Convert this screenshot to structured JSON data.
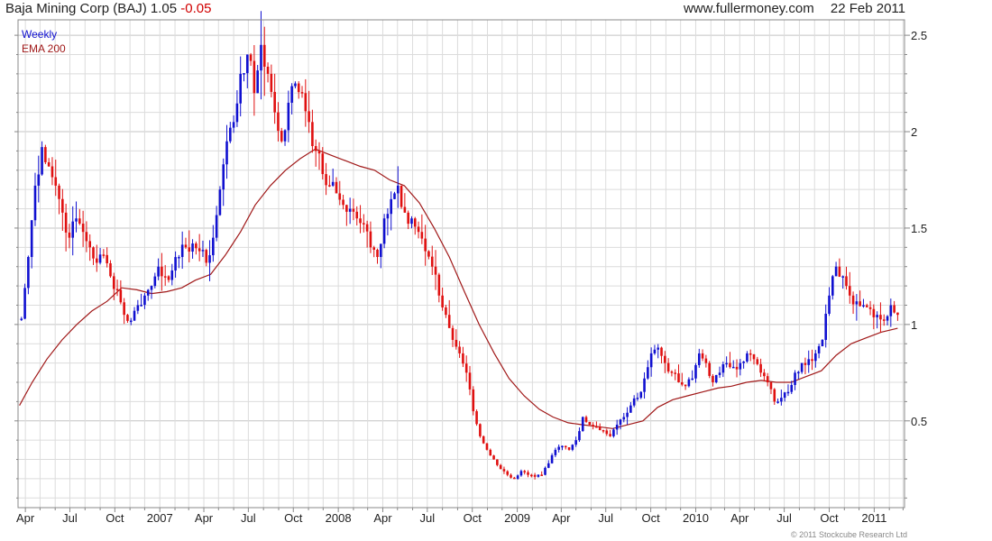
{
  "header": {
    "symbol": "Baja Mining Corp (BAJ)",
    "price": "1.05",
    "change": "-0.05",
    "site": "www.fullermoney.com",
    "date": "22 Feb 2011"
  },
  "footer": {
    "copyright": "© 2011 Stockcube Research Ltd"
  },
  "colors": {
    "up": "#1010d0",
    "down": "#e01010",
    "ema": "#a01818",
    "grid": "#dcdcdc",
    "major_grid": "#c4c4c4",
    "frame": "#888888"
  },
  "chart_data": {
    "type": "line",
    "title": "Baja Mining Corp (BAJ)",
    "interval": "Weekly",
    "x_ticks": [
      "Apr",
      "Jul",
      "Oct",
      "2007",
      "Apr",
      "Jul",
      "Oct",
      "2008",
      "Apr",
      "Jul",
      "Oct",
      "2009",
      "Apr",
      "Jul",
      "Oct",
      "2010",
      "Apr",
      "Jul",
      "Oct",
      "2011"
    ],
    "x_tick_dates": [
      "2006-04-01",
      "2006-07-01",
      "2006-10-01",
      "2007-01-01",
      "2007-04-01",
      "2007-07-01",
      "2007-10-01",
      "2008-01-01",
      "2008-04-01",
      "2008-07-01",
      "2008-10-01",
      "2009-01-01",
      "2009-04-01",
      "2009-07-01",
      "2009-10-01",
      "2010-01-01",
      "2010-04-01",
      "2010-07-01",
      "2010-10-01",
      "2011-01-01"
    ],
    "x_range": [
      "2006-03-17",
      "2011-03-04"
    ],
    "y_ticks": [
      0.5,
      1,
      1.5,
      2,
      2.5
    ],
    "ylim": [
      0.05,
      2.58
    ],
    "grid": true,
    "legend_position": "top-left",
    "series": [
      {
        "name": "Weekly",
        "kind": "price",
        "points": [
          [
            "2006-03-24",
            1.03
          ],
          [
            "2006-04-07",
            1.35
          ],
          [
            "2006-04-21",
            1.72
          ],
          [
            "2006-05-05",
            1.92
          ],
          [
            "2006-05-19",
            1.82
          ],
          [
            "2006-06-02",
            1.72
          ],
          [
            "2006-06-16",
            1.58
          ],
          [
            "2006-06-30",
            1.45
          ],
          [
            "2006-07-14",
            1.55
          ],
          [
            "2006-07-28",
            1.48
          ],
          [
            "2006-08-11",
            1.4
          ],
          [
            "2006-08-25",
            1.32
          ],
          [
            "2006-09-08",
            1.36
          ],
          [
            "2006-09-22",
            1.25
          ],
          [
            "2006-10-06",
            1.18
          ],
          [
            "2006-10-20",
            1.05
          ],
          [
            "2006-11-03",
            1.02
          ],
          [
            "2006-11-17",
            1.1
          ],
          [
            "2006-12-01",
            1.15
          ],
          [
            "2006-12-15",
            1.2
          ],
          [
            "2006-12-29",
            1.3
          ],
          [
            "2007-01-12",
            1.25
          ],
          [
            "2007-01-26",
            1.28
          ],
          [
            "2007-02-09",
            1.35
          ],
          [
            "2007-02-23",
            1.4
          ],
          [
            "2007-03-09",
            1.42
          ],
          [
            "2007-03-23",
            1.38
          ],
          [
            "2007-04-06",
            1.32
          ],
          [
            "2007-04-20",
            1.45
          ],
          [
            "2007-05-04",
            1.7
          ],
          [
            "2007-05-18",
            1.95
          ],
          [
            "2007-06-01",
            2.05
          ],
          [
            "2007-06-15",
            2.3
          ],
          [
            "2007-06-29",
            2.4
          ],
          [
            "2007-07-13",
            2.2
          ],
          [
            "2007-07-27",
            2.45
          ],
          [
            "2007-08-10",
            2.3
          ],
          [
            "2007-08-24",
            2.1
          ],
          [
            "2007-09-07",
            1.95
          ],
          [
            "2007-09-21",
            2.15
          ],
          [
            "2007-10-05",
            2.25
          ],
          [
            "2007-10-19",
            2.2
          ],
          [
            "2007-11-02",
            2.05
          ],
          [
            "2007-11-16",
            1.9
          ],
          [
            "2007-11-30",
            1.78
          ],
          [
            "2007-12-14",
            1.72
          ],
          [
            "2007-12-28",
            1.68
          ],
          [
            "2008-01-11",
            1.62
          ],
          [
            "2008-01-25",
            1.6
          ],
          [
            "2008-02-08",
            1.55
          ],
          [
            "2008-02-22",
            1.52
          ],
          [
            "2008-03-07",
            1.4
          ],
          [
            "2008-03-21",
            1.35
          ],
          [
            "2008-04-04",
            1.55
          ],
          [
            "2008-04-18",
            1.65
          ],
          [
            "2008-05-02",
            1.72
          ],
          [
            "2008-05-16",
            1.58
          ],
          [
            "2008-05-30",
            1.55
          ],
          [
            "2008-06-13",
            1.48
          ],
          [
            "2008-06-27",
            1.38
          ],
          [
            "2008-07-11",
            1.3
          ],
          [
            "2008-07-25",
            1.15
          ],
          [
            "2008-08-08",
            1.05
          ],
          [
            "2008-08-22",
            0.92
          ],
          [
            "2008-09-05",
            0.85
          ],
          [
            "2008-09-19",
            0.75
          ],
          [
            "2008-10-03",
            0.55
          ],
          [
            "2008-10-17",
            0.42
          ],
          [
            "2008-10-31",
            0.35
          ],
          [
            "2008-11-14",
            0.3
          ],
          [
            "2008-11-28",
            0.25
          ],
          [
            "2008-12-12",
            0.22
          ],
          [
            "2008-12-26",
            0.2
          ],
          [
            "2009-01-09",
            0.24
          ],
          [
            "2009-01-23",
            0.22
          ],
          [
            "2009-02-06",
            0.21
          ],
          [
            "2009-02-20",
            0.22
          ],
          [
            "2009-03-06",
            0.28
          ],
          [
            "2009-03-20",
            0.35
          ],
          [
            "2009-04-03",
            0.37
          ],
          [
            "2009-04-17",
            0.35
          ],
          [
            "2009-05-01",
            0.4
          ],
          [
            "2009-05-15",
            0.52
          ],
          [
            "2009-05-29",
            0.48
          ],
          [
            "2009-06-12",
            0.47
          ],
          [
            "2009-06-26",
            0.45
          ],
          [
            "2009-07-10",
            0.42
          ],
          [
            "2009-07-24",
            0.48
          ],
          [
            "2009-08-07",
            0.52
          ],
          [
            "2009-08-21",
            0.58
          ],
          [
            "2009-09-04",
            0.62
          ],
          [
            "2009-09-18",
            0.72
          ],
          [
            "2009-10-02",
            0.85
          ],
          [
            "2009-10-16",
            0.88
          ],
          [
            "2009-10-30",
            0.8
          ],
          [
            "2009-11-13",
            0.75
          ],
          [
            "2009-11-27",
            0.7
          ],
          [
            "2009-12-11",
            0.68
          ],
          [
            "2009-12-25",
            0.72
          ],
          [
            "2010-01-08",
            0.85
          ],
          [
            "2010-01-22",
            0.8
          ],
          [
            "2010-02-05",
            0.7
          ],
          [
            "2010-02-19",
            0.75
          ],
          [
            "2010-03-05",
            0.8
          ],
          [
            "2010-03-19",
            0.78
          ],
          [
            "2010-04-02",
            0.8
          ],
          [
            "2010-04-16",
            0.85
          ],
          [
            "2010-04-30",
            0.82
          ],
          [
            "2010-05-14",
            0.75
          ],
          [
            "2010-05-28",
            0.7
          ],
          [
            "2010-06-11",
            0.6
          ],
          [
            "2010-06-25",
            0.62
          ],
          [
            "2010-07-09",
            0.65
          ],
          [
            "2010-07-23",
            0.75
          ],
          [
            "2010-08-06",
            0.8
          ],
          [
            "2010-08-20",
            0.82
          ],
          [
            "2010-09-03",
            0.85
          ],
          [
            "2010-09-17",
            0.92
          ],
          [
            "2010-10-01",
            1.15
          ],
          [
            "2010-10-15",
            1.3
          ],
          [
            "2010-10-29",
            1.25
          ],
          [
            "2010-11-12",
            1.15
          ],
          [
            "2010-11-26",
            1.12
          ],
          [
            "2010-12-10",
            1.1
          ],
          [
            "2010-12-24",
            1.08
          ],
          [
            "2011-01-07",
            1.05
          ],
          [
            "2011-01-21",
            1.02
          ],
          [
            "2011-02-04",
            1.1
          ],
          [
            "2011-02-18",
            1.05
          ]
        ]
      },
      {
        "name": "EMA 200",
        "kind": "line",
        "points": [
          [
            "2006-03-20",
            0.58
          ],
          [
            "2006-04-15",
            0.7
          ],
          [
            "2006-05-15",
            0.82
          ],
          [
            "2006-06-15",
            0.92
          ],
          [
            "2006-07-15",
            1.0
          ],
          [
            "2006-08-15",
            1.07
          ],
          [
            "2006-09-15",
            1.12
          ],
          [
            "2006-10-15",
            1.19
          ],
          [
            "2006-11-15",
            1.18
          ],
          [
            "2006-12-15",
            1.16
          ],
          [
            "2007-01-15",
            1.17
          ],
          [
            "2007-02-15",
            1.19
          ],
          [
            "2007-03-15",
            1.23
          ],
          [
            "2007-04-15",
            1.26
          ],
          [
            "2007-05-15",
            1.36
          ],
          [
            "2007-06-15",
            1.48
          ],
          [
            "2007-07-15",
            1.62
          ],
          [
            "2007-08-15",
            1.72
          ],
          [
            "2007-09-15",
            1.8
          ],
          [
            "2007-10-15",
            1.86
          ],
          [
            "2007-11-15",
            1.91
          ],
          [
            "2007-12-15",
            1.88
          ],
          [
            "2008-01-15",
            1.85
          ],
          [
            "2008-02-15",
            1.82
          ],
          [
            "2008-03-15",
            1.8
          ],
          [
            "2008-04-15",
            1.75
          ],
          [
            "2008-05-15",
            1.72
          ],
          [
            "2008-06-15",
            1.63
          ],
          [
            "2008-07-15",
            1.5
          ],
          [
            "2008-08-15",
            1.35
          ],
          [
            "2008-09-15",
            1.17
          ],
          [
            "2008-10-15",
            1.0
          ],
          [
            "2008-11-15",
            0.85
          ],
          [
            "2008-12-15",
            0.72
          ],
          [
            "2009-01-15",
            0.63
          ],
          [
            "2009-02-15",
            0.56
          ],
          [
            "2009-03-15",
            0.52
          ],
          [
            "2009-04-15",
            0.49
          ],
          [
            "2009-05-15",
            0.48
          ],
          [
            "2009-06-15",
            0.47
          ],
          [
            "2009-07-15",
            0.46
          ],
          [
            "2009-08-15",
            0.48
          ],
          [
            "2009-09-15",
            0.5
          ],
          [
            "2009-10-15",
            0.57
          ],
          [
            "2009-11-15",
            0.61
          ],
          [
            "2009-12-15",
            0.63
          ],
          [
            "2010-01-15",
            0.65
          ],
          [
            "2010-02-15",
            0.67
          ],
          [
            "2010-03-15",
            0.68
          ],
          [
            "2010-04-15",
            0.7
          ],
          [
            "2010-05-15",
            0.71
          ],
          [
            "2010-06-15",
            0.7
          ],
          [
            "2010-07-15",
            0.7
          ],
          [
            "2010-08-15",
            0.73
          ],
          [
            "2010-09-15",
            0.76
          ],
          [
            "2010-10-15",
            0.84
          ],
          [
            "2010-11-15",
            0.9
          ],
          [
            "2010-12-15",
            0.93
          ],
          [
            "2011-01-15",
            0.96
          ],
          [
            "2011-02-18",
            0.98
          ]
        ]
      }
    ]
  }
}
